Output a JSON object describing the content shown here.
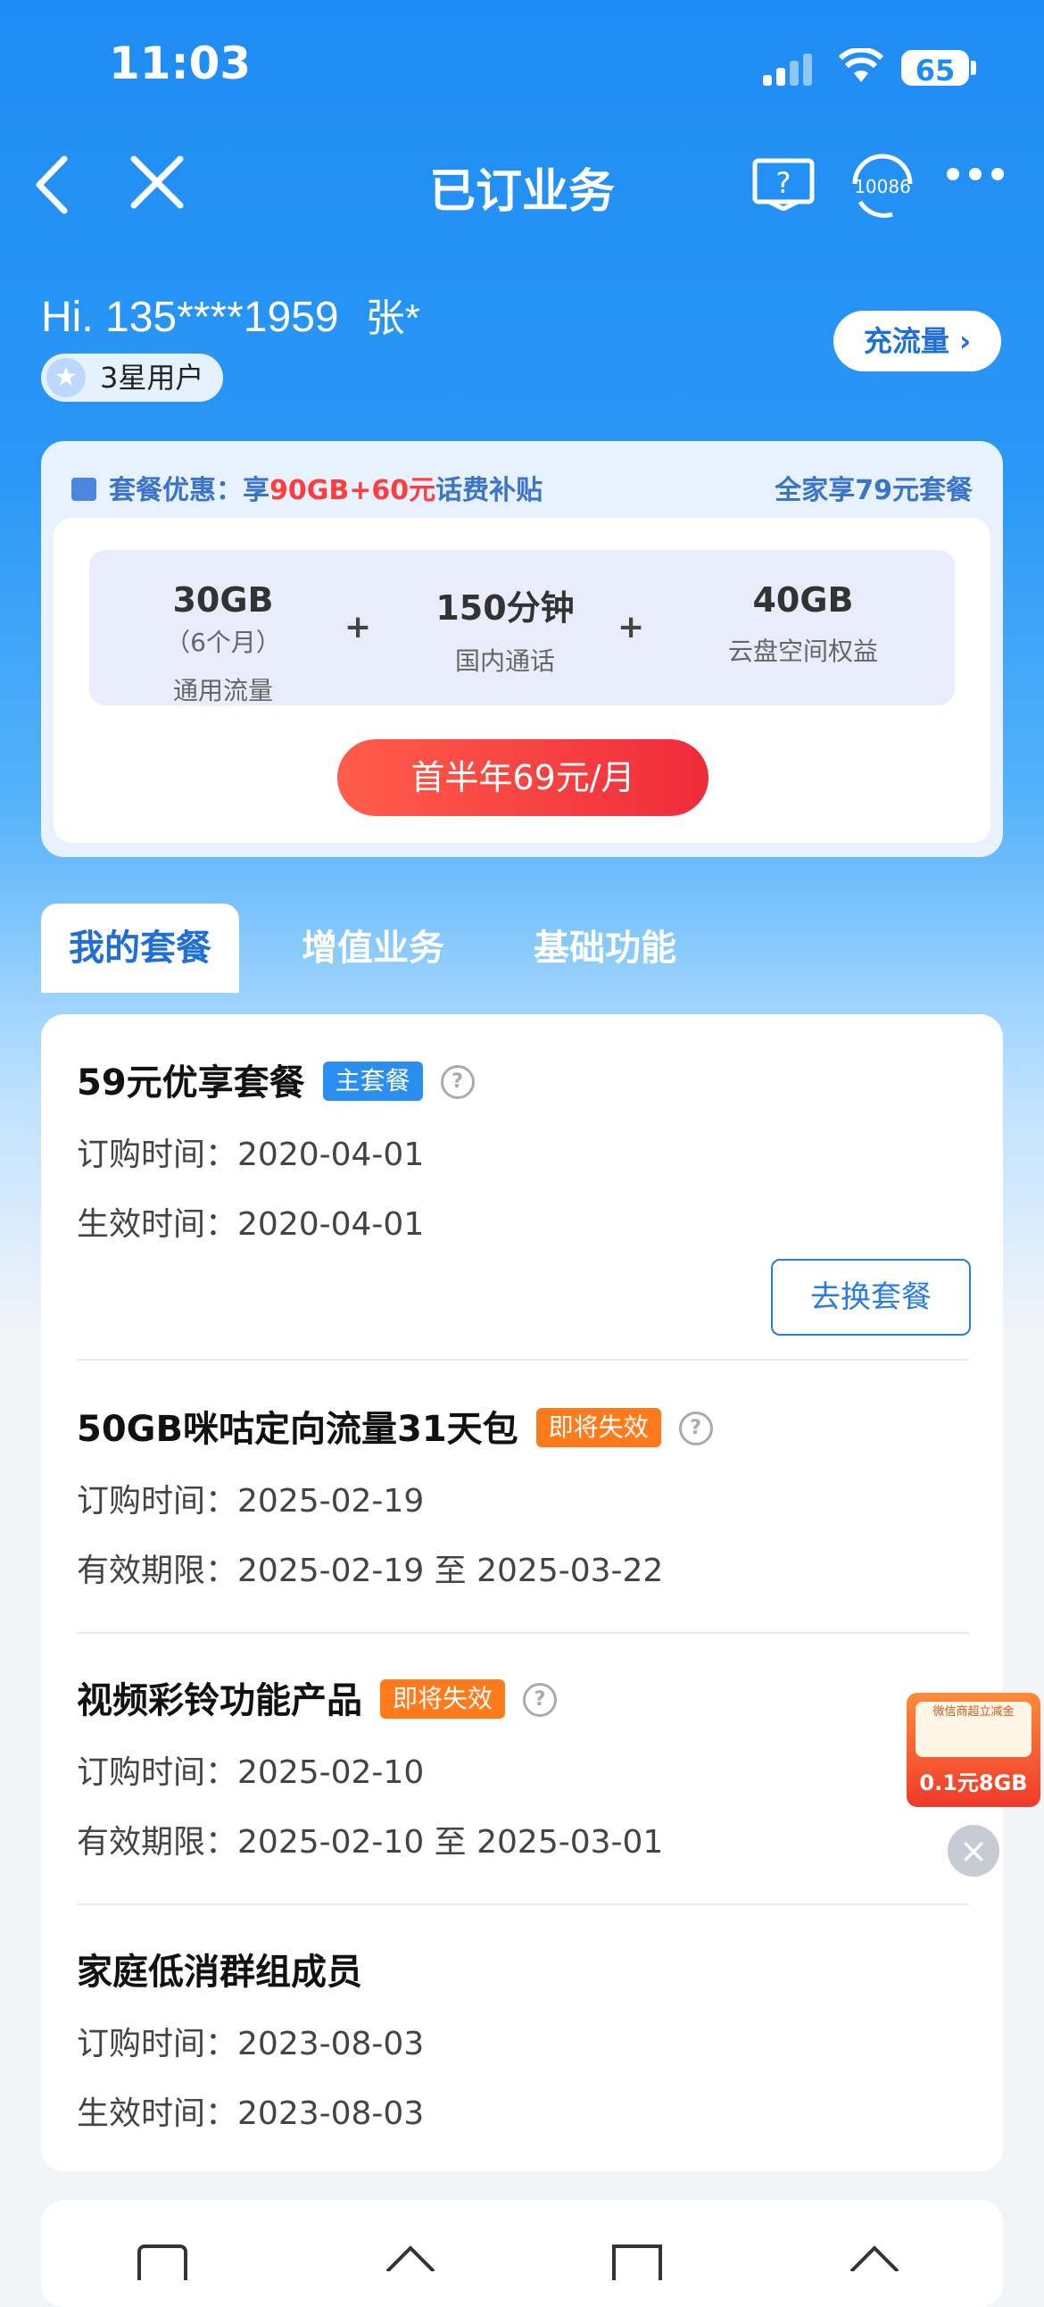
{
  "status_bar": {
    "time": "11:03",
    "battery": "65"
  },
  "nav": {
    "title": "已订业务",
    "service_number": "10086"
  },
  "user": {
    "greeting": "Hi. 135****1959",
    "name": "张*",
    "level": "3星用户",
    "recharge_label": "充流量"
  },
  "promo": {
    "label_prefix": "套餐优惠：享",
    "highlight": "90GB+60元",
    "label_suffix": "话费补贴",
    "right_link": "全家享79元套餐",
    "items": [
      {
        "value": "30GB",
        "note": "（6个月）",
        "desc": "通用流量"
      },
      {
        "value": "150分钟",
        "desc": "国内通话"
      },
      {
        "value": "40GB",
        "desc": "云盘空间权益"
      }
    ],
    "plus": "+",
    "cta": "首半年69元/月"
  },
  "tabs": [
    "我的套餐",
    "增值业务",
    "基础功能"
  ],
  "packages": [
    {
      "title": "59元优享套餐",
      "badge": "主套餐",
      "line1_label": "订购时间：",
      "line1_value": "2020-04-01",
      "line2_label": "生效时间：",
      "line2_value": "2020-04-01",
      "action": "去换套餐"
    },
    {
      "title": "50GB咪咕定向流量31天包",
      "badge": "即将失效",
      "line1_label": "订购时间：",
      "line1_value": "2025-02-19",
      "line2_label": "有效期限：",
      "line2_value": "2025-02-19 至 2025-03-22"
    },
    {
      "title": "视频彩铃功能产品",
      "badge": "即将失效",
      "line1_label": "订购时间：",
      "line1_value": "2025-02-10",
      "line2_label": "有效期限：",
      "line2_value": "2025-02-10 至 2025-03-01"
    },
    {
      "title": "家庭低消群组成员",
      "line1_label": "订购时间：",
      "line1_value": "2023-08-03",
      "line2_label": "生效时间：",
      "line2_value": "2023-08-03"
    }
  ],
  "float_ad": {
    "top_text": "微信商超立减金",
    "price": "0.1元8GB"
  },
  "help_mark": "?"
}
